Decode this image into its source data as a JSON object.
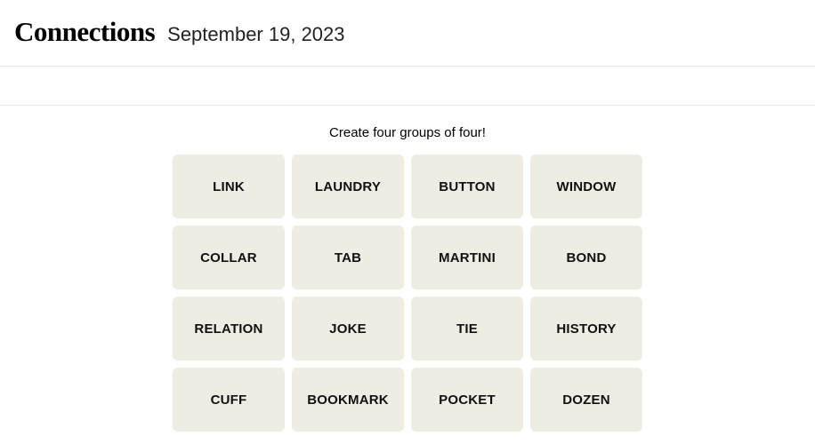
{
  "header": {
    "title": "Connections",
    "date": "September 19, 2023"
  },
  "instruction": "Create four groups of four!",
  "tiles": [
    "LINK",
    "LAUNDRY",
    "BUTTON",
    "WINDOW",
    "COLLAR",
    "TAB",
    "MARTINI",
    "BOND",
    "RELATION",
    "JOKE",
    "TIE",
    "HISTORY",
    "CUFF",
    "BOOKMARK",
    "POCKET",
    "DOZEN"
  ]
}
